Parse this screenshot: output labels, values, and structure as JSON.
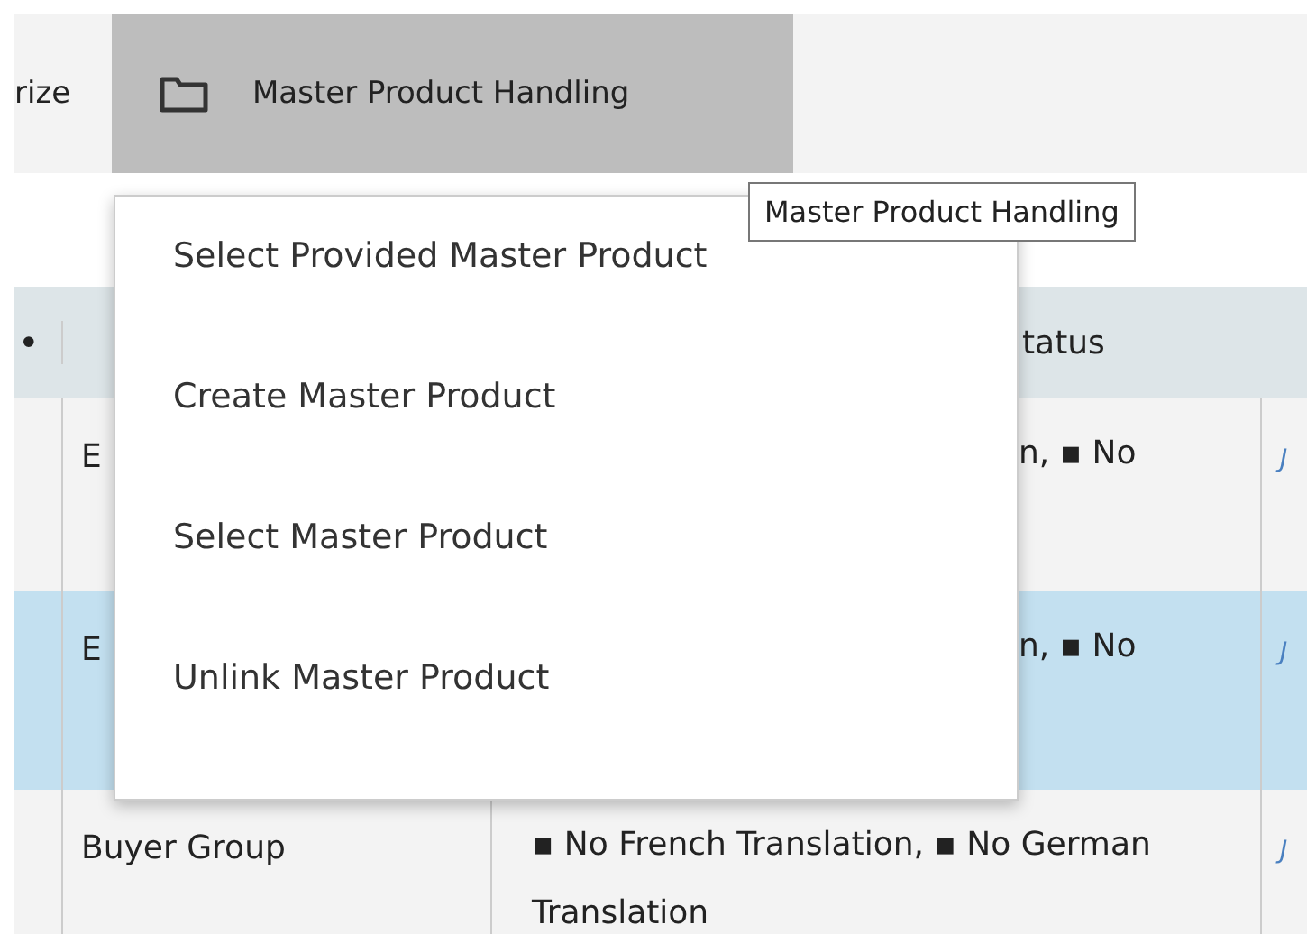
{
  "toolbar": {
    "partial_label": "rize",
    "button": {
      "label": "Master Product Handling",
      "selected": true
    }
  },
  "tooltip": "Master Product Handling",
  "menu": {
    "items": [
      {
        "label": "Select Provided Master Product"
      },
      {
        "label": "Create Master Product"
      },
      {
        "label": "Select Master Product"
      },
      {
        "label": "Unlink Master Product"
      }
    ]
  },
  "table": {
    "columns": [
      "•",
      "",
      "tatus",
      ""
    ],
    "rows": [
      {
        "selected": false,
        "cells": [
          "",
          "E",
          "n, ▪ No",
          "J"
        ]
      },
      {
        "selected": true,
        "cells": [
          "",
          "E",
          "n, ▪ No",
          "J"
        ]
      },
      {
        "selected": false,
        "cells": [
          "",
          "Buyer Group",
          "▪ No French Translation, ▪ No German Translation",
          "J"
        ]
      }
    ]
  }
}
